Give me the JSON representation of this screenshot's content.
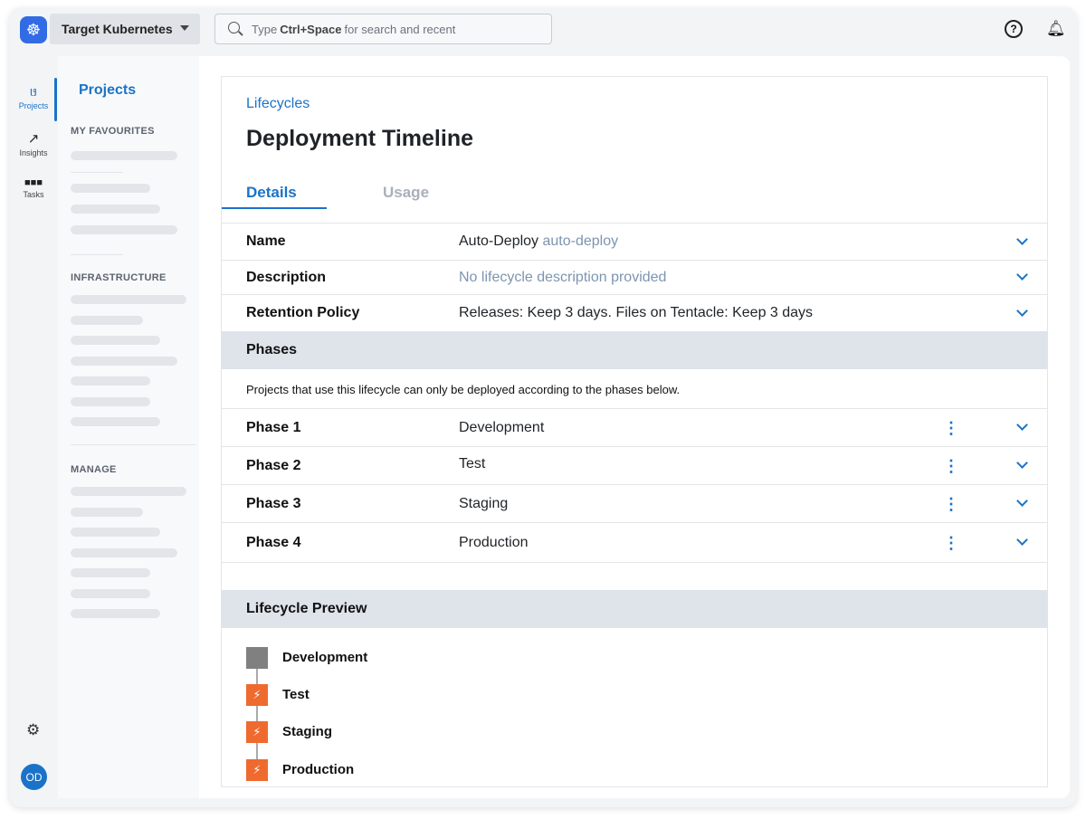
{
  "header": {
    "space": "Target Kubernetes",
    "search_prefix": "Type",
    "search_key": "Ctrl+Space",
    "search_suffix": "for search and recent",
    "help": "?"
  },
  "rail": [
    {
      "label": "Projects",
      "icon": "projects-icon"
    },
    {
      "label": "Insights",
      "icon": "chart-icon"
    },
    {
      "label": "Tasks",
      "icon": "tasks-icon"
    }
  ],
  "user": {
    "initials": "OD"
  },
  "sidebar": {
    "title": "Projects",
    "sections": [
      "MY FAVOURITES",
      "INFRASTRUCTURE",
      "MANAGE"
    ]
  },
  "page": {
    "breadcrumb": "Lifecycles",
    "title": "Deployment Timeline",
    "tabs": [
      "Details",
      "Usage"
    ]
  },
  "details": {
    "name_label": "Name",
    "name_value": "Auto-Deploy",
    "name_slug": "auto-deploy",
    "desc_label": "Description",
    "desc_value": "No lifecycle description provided",
    "retention_label": "Retention Policy",
    "retention_value": "Releases: Keep 3 days. Files on Tentacle: Keep 3 days"
  },
  "phases": {
    "header": "Phases",
    "note": "Projects that use this lifecycle can only be deployed according to the phases below.",
    "items": [
      {
        "label": "Phase 1",
        "name": "Development"
      },
      {
        "label": "Phase 2",
        "name": "Test"
      },
      {
        "label": "Phase 3",
        "name": "Staging"
      },
      {
        "label": "Phase 4",
        "name": "Production"
      }
    ]
  },
  "preview": {
    "header": "Lifecycle Preview",
    "items": [
      "Development",
      "Test",
      "Staging",
      "Production"
    ]
  },
  "colors": {
    "accent": "#1a73c8",
    "orange": "#ef6a2e",
    "gray": "#808080"
  }
}
